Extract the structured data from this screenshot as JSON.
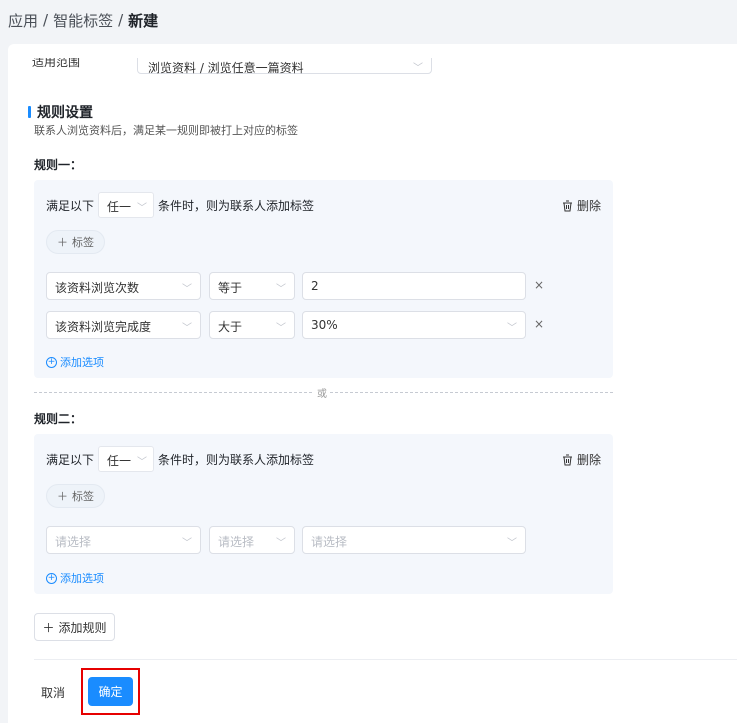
{
  "breadcrumb": {
    "part1": "应用",
    "sep1": "/",
    "part2": "智能标签",
    "sep2": "/",
    "current": "新建"
  },
  "scope": {
    "label": "适用范围",
    "value": "浏览资料 / 浏览任意一篇资料"
  },
  "rules_section": {
    "title": "规则设置",
    "description": "联系人浏览资料后，满足某一规则即被打上对应的标签"
  },
  "rules": [
    {
      "title": "规则一：",
      "cond_prefix": "满足以下",
      "match_mode": "任一",
      "cond_suffix": "条件时，则为联系人添加标签",
      "delete_label": "删除",
      "tag_label": "标签",
      "conditions": [
        {
          "field": "该资料浏览次数",
          "operator": "等于",
          "value": "2"
        },
        {
          "field": "该资料浏览完成度",
          "operator": "大于",
          "value": "30%"
        }
      ],
      "add_option": "添加选项"
    },
    {
      "title": "规则二：",
      "cond_prefix": "满足以下",
      "match_mode": "任一",
      "cond_suffix": "条件时，则为联系人添加标签",
      "delete_label": "删除",
      "tag_label": "标签",
      "conditions": [
        {
          "field": "请选择",
          "operator": "请选择",
          "value": "请选择"
        }
      ],
      "add_option": "添加选项"
    }
  ],
  "or_divider": "或",
  "add_rule": "添加规则",
  "footer": {
    "cancel": "取消",
    "confirm": "确定"
  },
  "colors": {
    "primary": "#1a8cff",
    "highlight": "#e60000",
    "panel": "#f4f7fc"
  }
}
